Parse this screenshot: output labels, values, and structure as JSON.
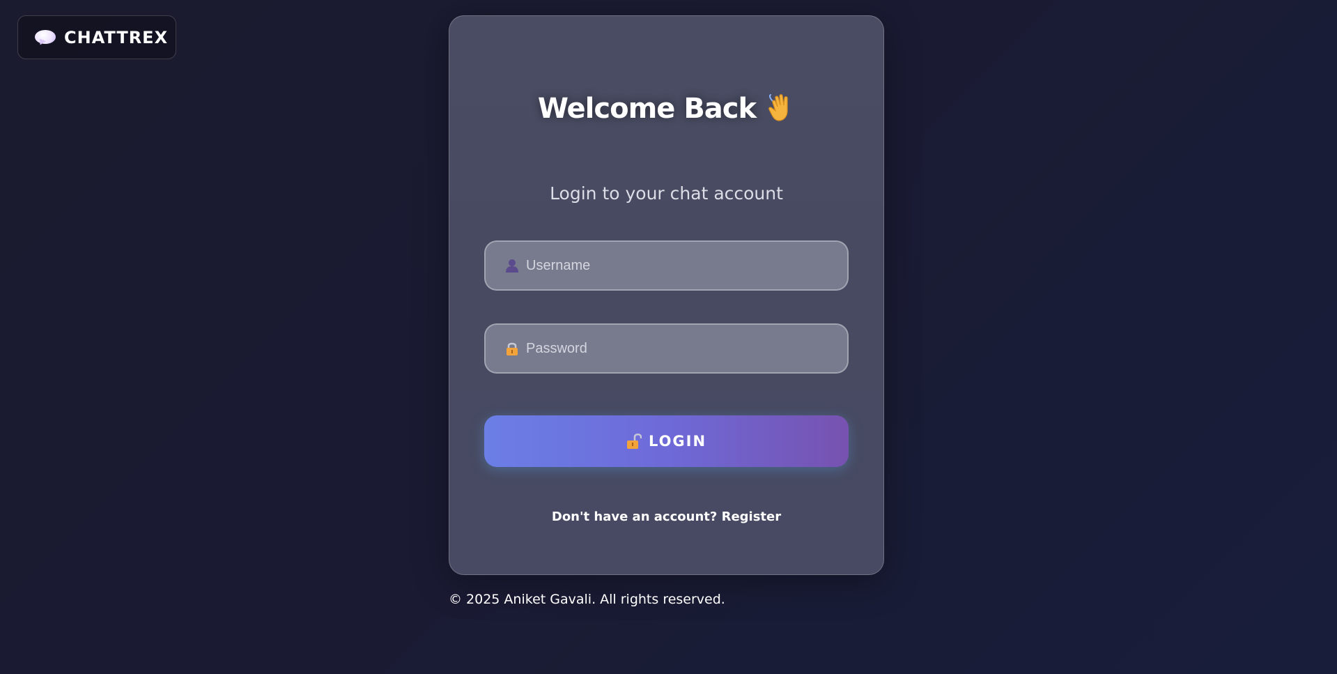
{
  "logo": {
    "icon": "speech-bubble-icon",
    "text": "CHATTREX"
  },
  "card": {
    "title": "Welcome Back",
    "title_emoji": "waving-hand-icon",
    "subtitle": "Login to your chat account",
    "username": {
      "icon": "user-icon",
      "placeholder": "Username",
      "value": ""
    },
    "password": {
      "icon": "lock-icon",
      "placeholder": "Password",
      "value": ""
    },
    "login_button": {
      "icon": "unlocked-icon",
      "label": "LOGIN"
    },
    "register_prompt": "Don't have an account?",
    "register_link": "Register"
  },
  "footer": {
    "text": "© 2025 Aniket Gavali. All rights reserved."
  },
  "colors": {
    "background": "#1a1b33",
    "card": "#484a62",
    "button_start": "#6b7fe6",
    "button_end": "#7752b0",
    "text": "#ffffff"
  }
}
